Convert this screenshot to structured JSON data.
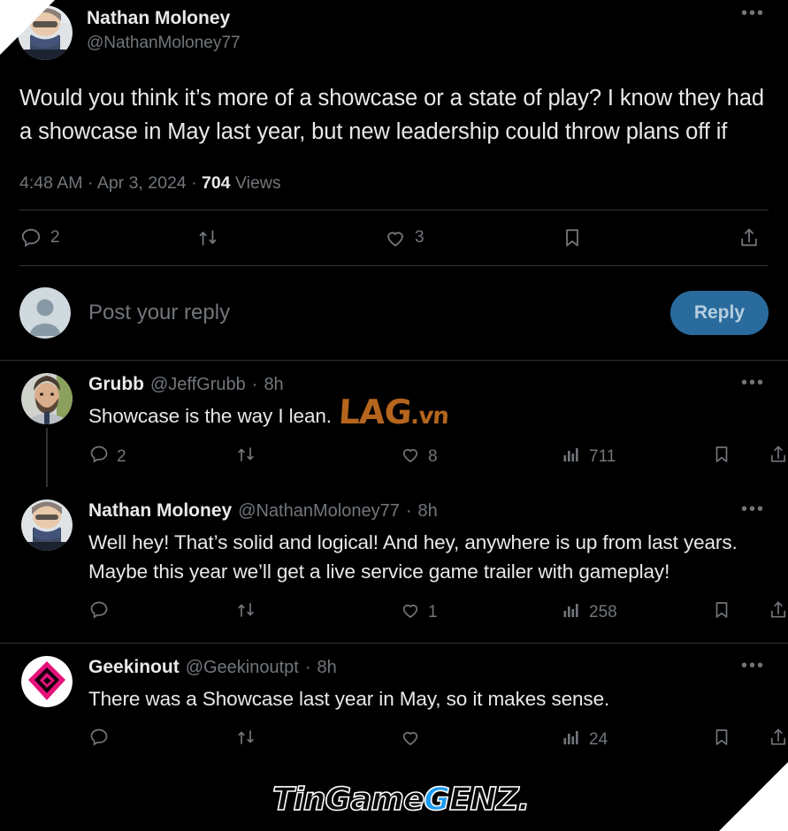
{
  "main_tweet": {
    "author_name": "Nathan Moloney",
    "author_handle": "@NathanMoloney77",
    "more_label": "•••",
    "body": "Would you think it’s more of a showcase or a state of play? I know they had a showcase in May last year, but new leadership could throw plans off if",
    "time": "4:48 AM",
    "sep1": "·",
    "date": "Apr 3, 2024",
    "sep2": "·",
    "views_count": "704",
    "views_label": "Views",
    "actions": {
      "reply_count": "2",
      "retweet_count": "",
      "like_count": "3",
      "bookmark_count": "",
      "share_count": ""
    }
  },
  "composer": {
    "placeholder": "Post your reply",
    "reply_button": "Reply",
    "avatar_name": "default-avatar"
  },
  "replies": [
    {
      "author_name": "Grubb",
      "author_handle": "@JeffGrubb",
      "separator": "·",
      "age": "8h",
      "more_label": "•••",
      "text": "Showcase is the way I lean.",
      "reply_count": "2",
      "retweet_count": "",
      "like_count": "8",
      "views_count": "711",
      "avatar_kind": "photo-bearded-man",
      "thread_line": true
    },
    {
      "author_name": "Nathan Moloney",
      "author_handle": "@NathanMoloney77",
      "separator": "·",
      "age": "8h",
      "more_label": "•••",
      "text": "Well hey! That’s solid and logical! And hey, anywhere is up from last years. Maybe this year we’ll get a live service game trailer with gameplay!",
      "reply_count": "",
      "retweet_count": "",
      "like_count": "1",
      "views_count": "258",
      "avatar_kind": "photo-masked-person",
      "thread_line": false
    },
    {
      "author_name": "Geekinout",
      "author_handle": "@Geekinoutpt",
      "separator": "·",
      "age": "8h",
      "more_label": "•••",
      "text": "There was a Showcase last year in May, so it makes sense.",
      "reply_count": "",
      "retweet_count": "",
      "like_count": "",
      "views_count": "24",
      "avatar_kind": "logo-pink-diamond",
      "thread_line": false
    }
  ],
  "watermarks": {
    "lag_main": "LAG",
    "lag_suffix": ".vn",
    "tgz_part1": "TinGame",
    "tgz_part2": "G",
    "tgz_part3": "ENZ."
  },
  "colors": {
    "background": "#000000",
    "text": "#e7e9ea",
    "muted": "#71767b",
    "divider": "#2f3336",
    "reply_button": "#2a6b9e",
    "accent_blue": "#1d9bf0",
    "watermark_orange": "#b5651d",
    "watermark_pink": "#e6127a"
  }
}
